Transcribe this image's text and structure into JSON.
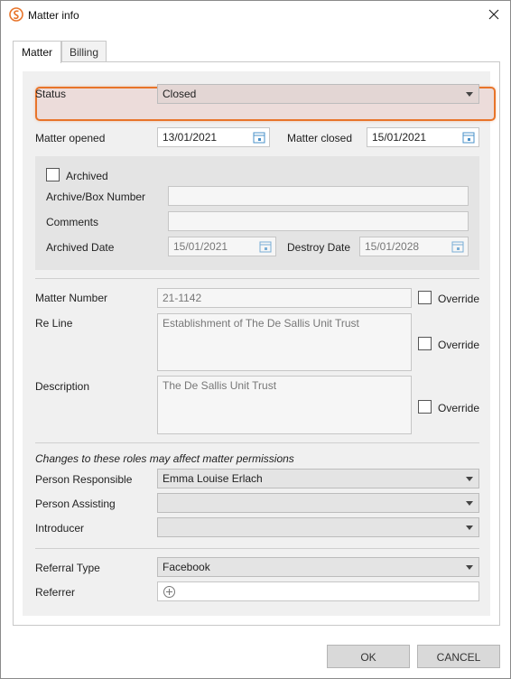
{
  "window": {
    "title": "Matter info"
  },
  "tabs": [
    {
      "label": "Matter"
    },
    {
      "label": "Billing"
    }
  ],
  "matter": {
    "status": {
      "label": "Status",
      "value": "Closed"
    },
    "opened": {
      "label": "Matter opened",
      "value": "13/01/2021"
    },
    "closed": {
      "label": "Matter closed",
      "value": "15/01/2021"
    },
    "archive": {
      "archived_label": "Archived",
      "box_number_label": "Archive/Box Number",
      "box_number_value": "",
      "comments_label": "Comments",
      "comments_value": "",
      "archived_date_label": "Archived Date",
      "archived_date_value": "15/01/2021",
      "destroy_date_label": "Destroy Date",
      "destroy_date_value": "15/01/2028"
    },
    "number": {
      "label": "Matter Number",
      "value": "21-1142",
      "override_label": "Override"
    },
    "re_line": {
      "label": "Re Line",
      "value": "Establishment of The De Sallis Unit Trust",
      "override_label": "Override"
    },
    "description": {
      "label": "Description",
      "value": "The De Sallis Unit Trust",
      "override_label": "Override"
    },
    "roles_note": "Changes to these roles may affect matter permissions",
    "person_responsible": {
      "label": "Person Responsible",
      "value": "Emma Louise Erlach"
    },
    "person_assisting": {
      "label": "Person Assisting",
      "value": ""
    },
    "introducer": {
      "label": "Introducer",
      "value": ""
    },
    "referral_type": {
      "label": "Referral Type",
      "value": "Facebook"
    },
    "referrer": {
      "label": "Referrer"
    }
  },
  "buttons": {
    "ok": "OK",
    "cancel": "CANCEL"
  },
  "colors": {
    "highlight": "#e8742a",
    "accent": "#4a90c8"
  }
}
